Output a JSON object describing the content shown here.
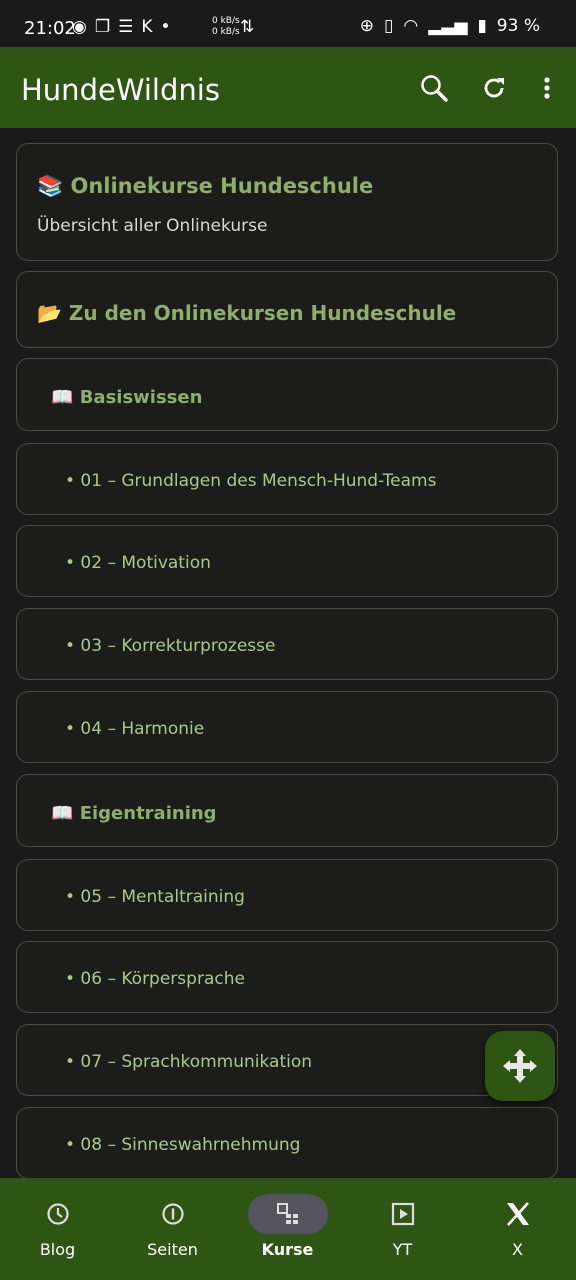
{
  "status": {
    "time": "21:02",
    "net_up": "0 kB/s",
    "net_down": "0 kB/s",
    "battery": "93 %"
  },
  "appbar": {
    "title": "HundeWildnis",
    "search_icon": "search-icon",
    "refresh_icon": "refresh-icon",
    "menu_icon": "more-vert-icon"
  },
  "cards": {
    "header": {
      "emoji": "📚",
      "title": "Onlinekurse Hundeschule",
      "subtitle": "Übersicht aller Onlinekurse"
    },
    "link": {
      "emoji": "📂",
      "title": "Zu den Onlinekursen Hundeschule"
    },
    "section1": {
      "emoji": "📖",
      "title": "Basiswissen"
    },
    "items1": [
      "• 01 – Grundlagen des Mensch-Hund-Teams",
      "• 02 – Motivation",
      "• 03 – Korrekturprozesse",
      "• 04 – Harmonie"
    ],
    "section2": {
      "emoji": "📖",
      "title": "Eigentraining"
    },
    "items2": [
      "• 05 – Mentaltraining",
      "• 06 – Körpersprache",
      "• 07 – Sprachkommunikation",
      "• 08 – Sinneswahrnehmung"
    ]
  },
  "fab": {
    "icon": "move-arrows-icon"
  },
  "nav": [
    {
      "label": "Blog",
      "icon": "clock-icon",
      "active": false
    },
    {
      "label": "Seiten",
      "icon": "info-circle-icon",
      "active": false
    },
    {
      "label": "Kurse",
      "icon": "courses-icon",
      "active": true
    },
    {
      "label": "YT",
      "icon": "play-box-icon",
      "active": false
    },
    {
      "label": "X",
      "icon": "x-logo-icon",
      "active": false
    }
  ],
  "colors": {
    "appbar": "#2f5514",
    "accent_green": "#8fad6b",
    "item_green": "#a9c98b",
    "background": "#191a19"
  }
}
